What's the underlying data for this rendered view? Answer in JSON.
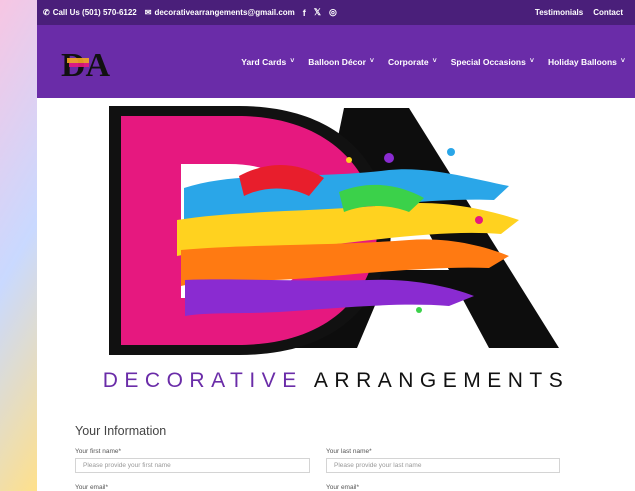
{
  "topbar": {
    "phone": "Call Us (501) 570-6122",
    "email": "decorativearrangements@gmail.com",
    "social": [
      "f",
      "𝕏",
      "◎"
    ],
    "links": [
      "Testimonials",
      "Contact"
    ]
  },
  "nav": {
    "logo_text": "DA",
    "items": [
      "Yard Cards",
      "Balloon Décor",
      "Corporate",
      "Special Occasions",
      "Holiday Balloons"
    ]
  },
  "hero": {
    "logo_letters": "DA",
    "tagline_first": "DECORATIVE",
    "tagline_second": "ARRANGEMENTS"
  },
  "form": {
    "heading": "Your Information",
    "first_name_label": "Your first name*",
    "first_name_placeholder": "Please provide your first name",
    "last_name_label": "Your last name*",
    "last_name_placeholder": "Please provide your last name",
    "email_label_1": "Your email*",
    "email_label_2": "Your email*"
  },
  "colors": {
    "topbar": "#4a1f7a",
    "header": "#6a2ca8",
    "pink": "#e6187f"
  }
}
